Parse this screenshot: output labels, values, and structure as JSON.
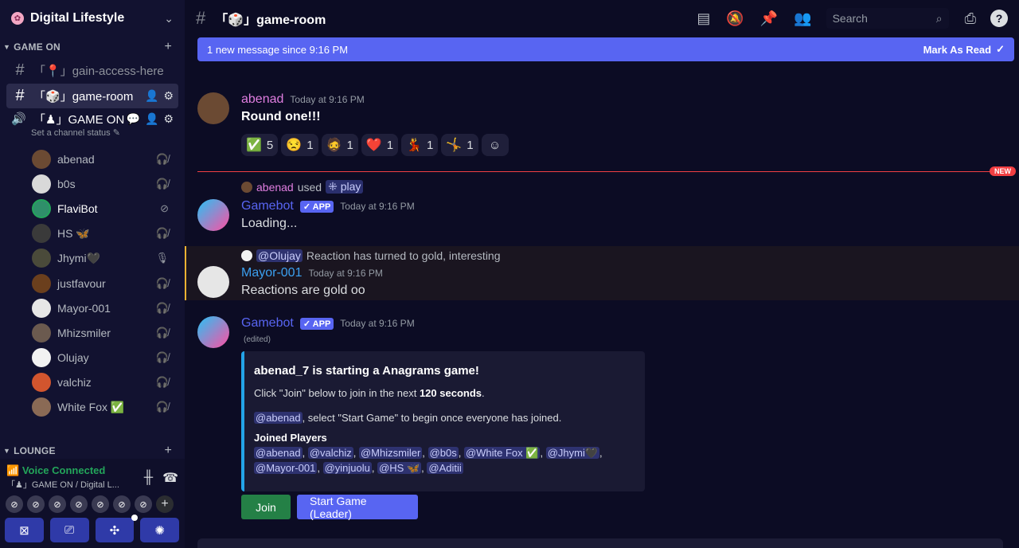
{
  "server": {
    "name": "Digital Lifestyle"
  },
  "categories": {
    "game_on": "GAME ON",
    "lounge": "LOUNGE"
  },
  "channels": [
    {
      "prefix": "「📍」",
      "name": "gain-access-here"
    },
    {
      "prefix": "「🎲」",
      "name": "game-room"
    }
  ],
  "voice_channel": {
    "name": "「♟」GAME ON",
    "status": "Set a channel status"
  },
  "voice_users": [
    {
      "name": "abenad",
      "color": "#6b4a33"
    },
    {
      "name": "b0s",
      "color": "#d9d9d9"
    },
    {
      "name": "FlaviBot",
      "color": "#2f8f6a"
    },
    {
      "name": "HS 🦋",
      "color": "#3a3a3a"
    },
    {
      "name": "Jhymi🖤",
      "color": "#4a4a3a"
    },
    {
      "name": "justfavour",
      "color": "#6b3f1d"
    },
    {
      "name": "Mayor-001",
      "color": "#e6e6e6"
    },
    {
      "name": "Mhizsmiler",
      "color": "#6b5a4f"
    },
    {
      "name": "Olujay",
      "color": "#f2f2f2"
    },
    {
      "name": "valchiz",
      "color": "#d2552e"
    },
    {
      "name": "White Fox ✅",
      "color": "#8a6a55"
    }
  ],
  "voice_panel": {
    "title": "Voice Connected",
    "subtitle": "「♟」GAME ON / Digital L..."
  },
  "header": {
    "channel_title": "「🎲」game-room",
    "search_placeholder": "Search"
  },
  "new_messages_bar": {
    "text": "1 new message since 9:16 PM",
    "action": "Mark As Read"
  },
  "messages": {
    "m1": {
      "author": "abenad",
      "time": "Today at 9:16 PM",
      "text": "Round one!!!",
      "reactions": [
        {
          "emoji": "✅",
          "count": "5"
        },
        {
          "emoji": "😒",
          "count": "1"
        },
        {
          "emoji": "🧔",
          "count": "1"
        },
        {
          "emoji": "❤️",
          "count": "1"
        },
        {
          "emoji": "💃",
          "count": "1"
        },
        {
          "emoji": "🤸",
          "count": "1"
        }
      ]
    },
    "new_label": "NEW",
    "m2": {
      "reply_user": "abenad",
      "reply_used": "used",
      "reply_cmd": "⁜ play",
      "author": "Gamebot",
      "tag": "✓ APP",
      "time": "Today at 9:16 PM",
      "text": "Loading..."
    },
    "m3": {
      "reply_user": "@Olujay",
      "reply_text": "Reaction has turned to gold, interesting",
      "author": "Mayor-001",
      "time": "Today at 9:16 PM",
      "text": "Reactions are gold oo"
    },
    "m4": {
      "author": "Gamebot",
      "tag": "✓ APP",
      "time": "Today at 9:16 PM",
      "edited": "(edited)",
      "embed": {
        "title": "abenad_7 is starting a Anagrams game!",
        "line1_pre": "Click \"Join\" below to join in the next ",
        "line1_bold": "120 seconds",
        "line1_post": ".",
        "line2_mention": "@abenad",
        "line2_text": ", select \"Start Game\" to begin once everyone has joined.",
        "field_name": "Joined Players",
        "players": [
          "@abenad",
          "@valchiz",
          "@Mhizsmiler",
          "@b0s",
          "@White Fox ✅",
          "@Jhymi🖤",
          "@Mayor-001",
          "@yinjuolu",
          "@HS 🦋",
          "@Aditii"
        ]
      },
      "buttons": {
        "join": "Join",
        "start": "Start Game (Leader)"
      }
    }
  },
  "colors": {
    "accent": "#5865f2",
    "danger": "#f23f43",
    "success": "#23a55a",
    "abenad": "#e07ee0",
    "bot": "#5865f2",
    "mayor": "#3ba0f0"
  }
}
